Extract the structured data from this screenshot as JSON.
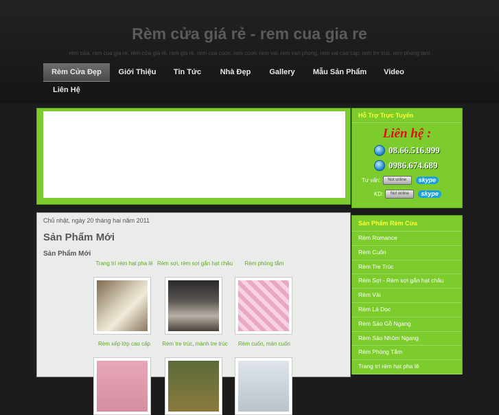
{
  "header": {
    "title": "Rèm cửa giá rẻ - rem cua gia re",
    "tagline": "rèm cửa, rem cua gia re, rèm cửa giá rẻ, rem gia re, rem cua cuon, rem cuon, rem vai, rem van phong, rem vai cao cap, rem tre truc, rem phong tam"
  },
  "nav": {
    "items": [
      {
        "label": "Rèm Cửa Đẹp"
      },
      {
        "label": "Giới Thiệu"
      },
      {
        "label": "Tin Tức"
      },
      {
        "label": "Nhà Đẹp"
      },
      {
        "label": "Gallery"
      },
      {
        "label": "Mẫu Sản Phẩm"
      },
      {
        "label": "Video"
      },
      {
        "label": "Liên Hệ"
      }
    ]
  },
  "support": {
    "heading": "Hỗ Trợ Trực Tuyến",
    "contact_title": "Liên hệ :",
    "phones": [
      "08.66.516.999",
      "0986.674.689"
    ],
    "chat": [
      {
        "label": "Tư vấn:",
        "status": "Not online",
        "service": "skype"
      },
      {
        "label": "KD:",
        "status": "Not online",
        "service": "skype"
      }
    ]
  },
  "main": {
    "date": "Chủ nhật, ngày 20 tháng hai năm 2011",
    "title": "Sản Phẩm Mới",
    "subtitle": "Sản Phẩm Mới",
    "products_row1": [
      "Trang trí rèm hạt pha lê",
      "Rèm sợi, rèm sợi gắn hạt châu",
      "Rèm phòng tắm"
    ],
    "products_row2": [
      "Rèm xếp lớp cao cấp",
      "Rèm tre trúc, mành tre trúc",
      "Rèm cuốn, màn cuốn"
    ]
  },
  "categories": {
    "heading": "Sản Phẩm Rèm Cửa",
    "items": [
      "Rèm Romance",
      "Rèm Cuốn",
      "Rèm Tre Trúc",
      "Rèm Sợi - Rèm sợi gắn hạt châu",
      "Rèm Vải",
      "Rèm Lá Dọc",
      "Rèm Sáo Gỗ Ngang",
      "Rèm Sáo Nhôm Ngang",
      "Rèm Phòng Tắm",
      "Trang trí rèm hạt pha lê"
    ]
  },
  "colors": {
    "accent": "#7ccc2d",
    "heading_yellow": "#ffff33",
    "link_green": "#5fa822"
  }
}
